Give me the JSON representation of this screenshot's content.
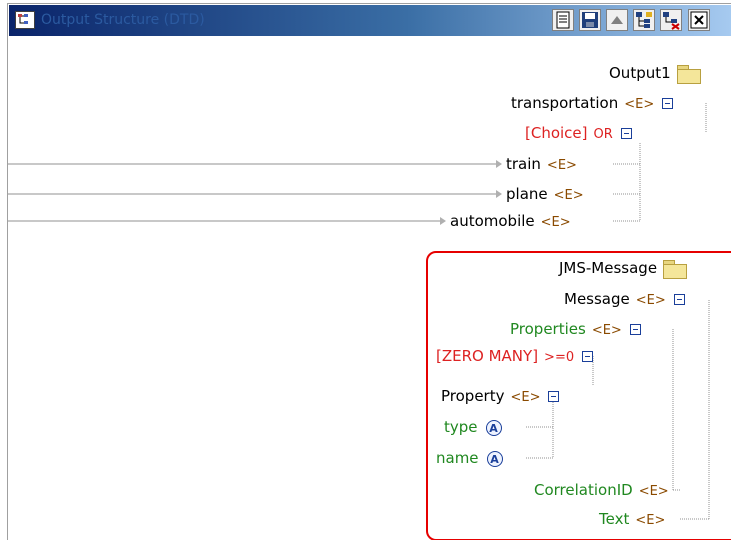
{
  "window": {
    "title": "Output Structure (DTD)",
    "toolbar": [
      "document-icon",
      "save-icon",
      "collapse-up-icon",
      "tree-options-icon",
      "tree-delete-icon",
      "close-icon"
    ]
  },
  "tree": {
    "root": "Output1",
    "transportation": {
      "label": "transportation",
      "tag": "<E>"
    },
    "choice": {
      "label": "[Choice]",
      "op": "OR"
    },
    "train": {
      "label": "train",
      "tag": "<E>"
    },
    "plane": {
      "label": "plane",
      "tag": "<E>"
    },
    "automobile": {
      "label": "automobile",
      "tag": "<E>"
    },
    "jms_message": "JMS-Message",
    "message": {
      "label": "Message",
      "tag": "<E>"
    },
    "properties": {
      "label": "Properties",
      "tag": "<E>"
    },
    "zero_many": {
      "label": "[ZERO MANY]",
      "op": ">=0"
    },
    "property": {
      "label": "Property",
      "tag": "<E>"
    },
    "type": {
      "label": "type",
      "badge": "A"
    },
    "name": {
      "label": "name",
      "badge": "A"
    },
    "correlation_id": {
      "label": "CorrelationID",
      "tag": "<E>"
    },
    "text": {
      "label": "Text",
      "tag": "<E>"
    }
  },
  "colors": {
    "element_tag": "#8a4a00",
    "green_label": "#208820",
    "red_label": "#dd2222",
    "highlight": "#e60000"
  }
}
